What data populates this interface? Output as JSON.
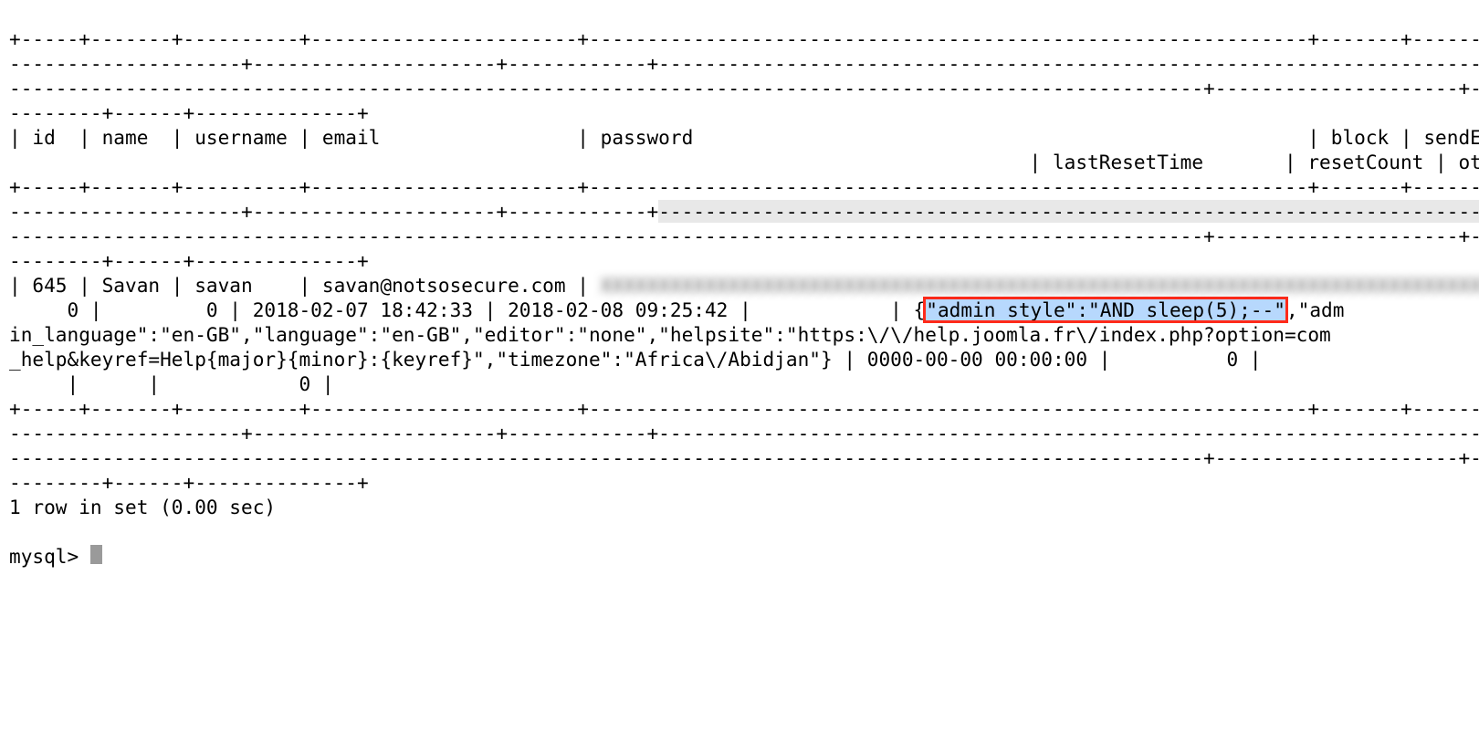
{
  "lines": {
    "l00": "+-----+-------+----------+-----------------------+--------------------------------------------------------------+-------+-----------+-",
    "l01": "--------------------+---------------------+------------+-----------------------------------------------------------------------------------",
    "l02": "-------------------------------------------------------------------------------------------------------+---------------------+------------+",
    "l03": "--------+------+--------------+",
    "l04": "| id  | name  | username | email                 | password                                                     | block | sendEmail | registerDate        | lastvisitDate       | activation | params                                                                                                                                                                                    ",
    "l05": "                                                                                        | lastResetTime       | resetCount | otpKey | otep | requireReset |",
    "l06": "+-----+-------+----------+-----------------------+--------------------------------------------------------------+-------+-----------+-",
    "l07": "--------------------+---------------------+------------+",
    "l07sel": "-----------------------------------------------------------------------------------",
    "l08": "-------------------------------------------------------------------------------------------------------+---------------------+------------+",
    "l09": "--------+------+--------------+",
    "l10a": "| 645 | Savan | savan    | savan@notsosecure.com | ",
    "l10blur": "XXXXXXXXXXXXXXXXXXXXXXXXXXXXXXXXXXXXXXXXXXXXXXXXXXXXXXXXXXXXXXXXXXXXXXXXXXXXXXXX",
    "l11a": "     0 |         0 | 2018-02-07 18:42:33 | 2018-02-08 09:25:42 |            | {",
    "l11hl": "\"admin_style\":\"AND sleep(5);--\"",
    "l11b": ",\"adm",
    "l12": "in_language\":\"en-GB\",\"language\":\"en-GB\",\"editor\":\"none\",\"helpsite\":\"https:\\/\\/help.joomla.fr\\/index.php?option=com",
    "l13": "_help&keyref=Help{major}{minor}:{keyref}\",\"timezone\":\"Africa\\/Abidjan\"} | 0000-00-00 00:00:00 |          0 |   ",
    "l14": "     |      |            0 |",
    "l15": "+-----+-------+----------+-----------------------+--------------------------------------------------------------+-------+-----------+-",
    "l16": "--------------------+---------------------+------------+-----------------------------------------------------------------------------------",
    "l17": "-------------------------------------------------------------------------------------------------------+---------------------+------------+",
    "l18": "--------+------+--------------+",
    "l19": "1 row in set (0.00 sec)",
    "l20": "",
    "l21": "mysql> "
  },
  "record": {
    "id": 645,
    "name": "Savan",
    "username": "savan",
    "email": "savan@notsosecure.com",
    "password": "[REDACTED]",
    "block": 0,
    "sendEmail": 0,
    "registerDate": "2018-02-07 18:42:33",
    "lastvisitDate": "2018-02-08 09:25:42",
    "activation": "",
    "params": {
      "admin_style": "AND sleep(5);--",
      "admin_language": "en-GB",
      "language": "en-GB",
      "editor": "none",
      "helpsite": "https://help.joomla.fr/index.php?option=com_help&keyref=Help{major}{minor}:{keyref}",
      "timezone": "Africa/Abidjan"
    },
    "lastResetTime": "0000-00-00 00:00:00",
    "resetCount": 0,
    "otpKey": "",
    "otep": "",
    "requireReset": 0
  },
  "footer": "1 row in set (0.00 sec)",
  "prompt": "mysql> "
}
